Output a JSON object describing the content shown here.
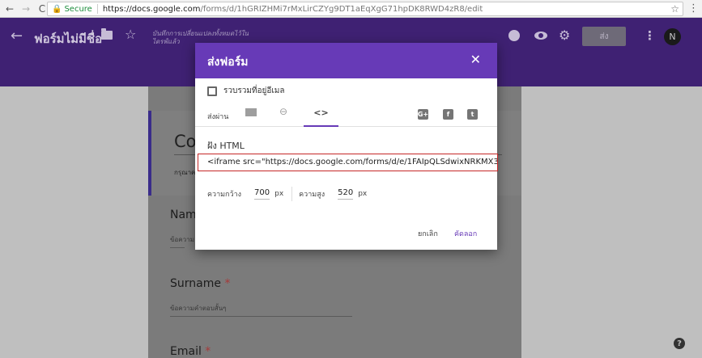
{
  "browser": {
    "secure_label": "Secure",
    "url_host": "https://docs.google.com",
    "url_path": "/forms/d/1hGRIZHMi7rMxLirCZYg9DT1aEqXgG71hpDK8RWD4zR8/edit"
  },
  "header": {
    "form_name": "ฟอร์มไม่มีชื่อ",
    "saved_note": "บันทึกการเปลี่ยนแปลงทั้งหมดไว้ในไดรฟ์แล้ว",
    "send_label": "ส่ง",
    "avatar_letter": "N"
  },
  "form": {
    "title": "Cor",
    "description": "กรุณาคอ",
    "questions": [
      {
        "label": "Name",
        "placeholder": "ข้อความ"
      },
      {
        "label": "Surname",
        "placeholder": "ข้อความคำตอบสั้นๆ"
      },
      {
        "label": "Email",
        "placeholder": ""
      }
    ],
    "required_mark": "*"
  },
  "dialog": {
    "title": "ส่งฟอร์ม",
    "collect_email_label": "รวบรวมที่อยู่อีเมล",
    "send_via_label": "ส่งผ่าน",
    "embed_tab_glyph": "<>",
    "embed_title": "ฝัง HTML",
    "embed_code": "<iframe src=\"https://docs.google.com/forms/d/e/1FAIpQLSdwixNRKMX3_l2",
    "width_label": "ความกว้าง",
    "width_value": "700",
    "height_label": "ความสูง",
    "height_value": "520",
    "unit": "px",
    "cancel_label": "ยกเลิก",
    "copy_label": "คัดลอก"
  },
  "colors": {
    "accent": "#673ab7",
    "highlight_border": "#c62828"
  }
}
